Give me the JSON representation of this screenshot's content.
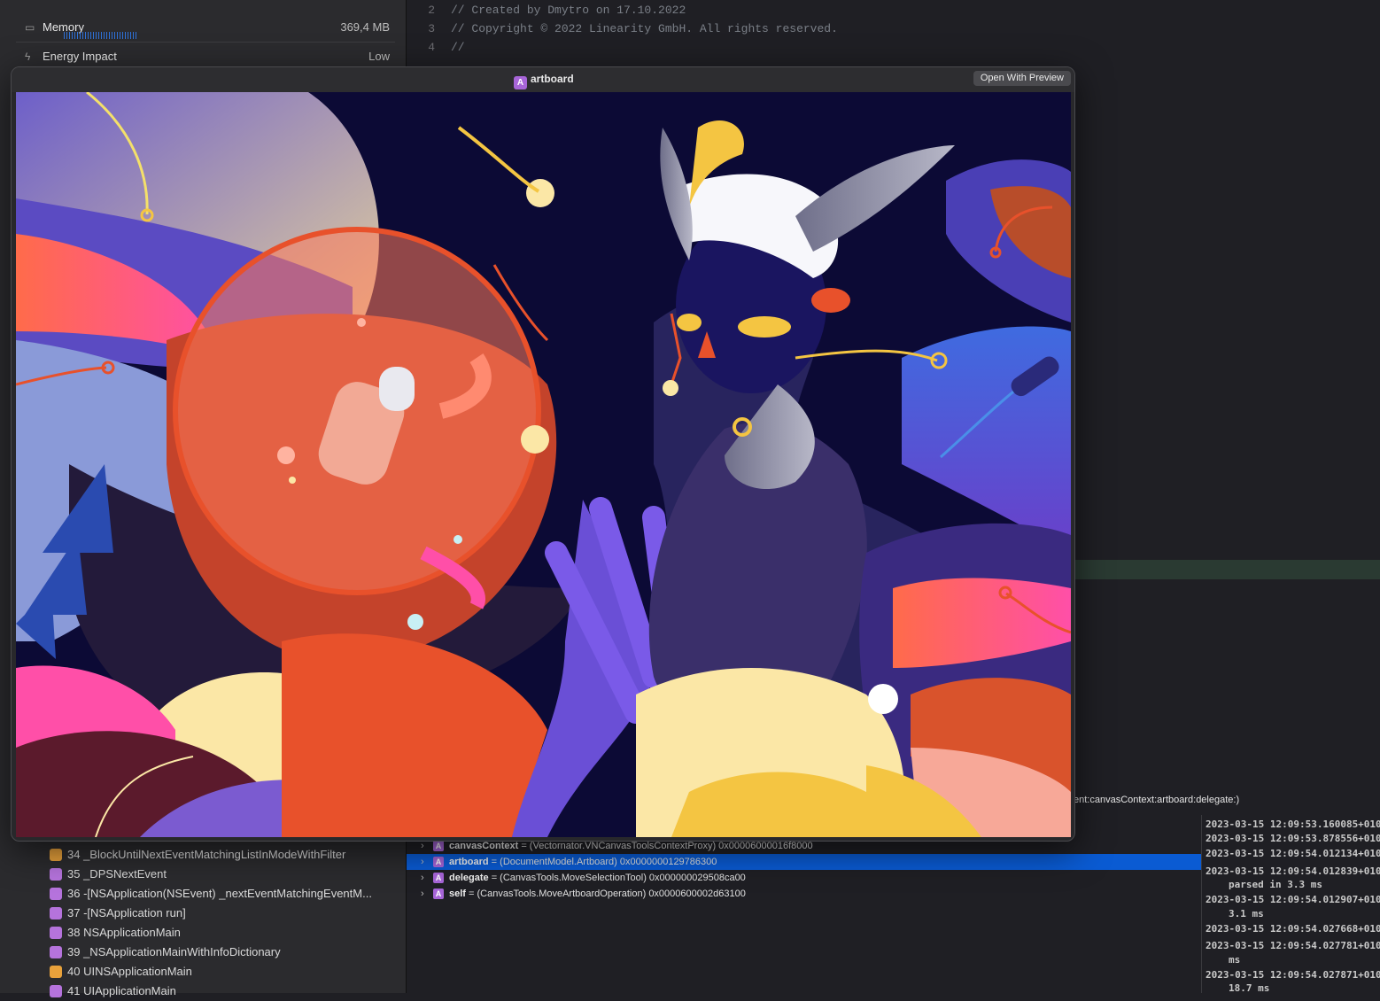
{
  "gauges": [
    {
      "label": "Memory",
      "value": "369,4 MB",
      "icon": "memory-chip-icon"
    },
    {
      "label": "Energy Impact",
      "value": "Low",
      "icon": "bolt-icon"
    }
  ],
  "frames": [
    {
      "text": "34 _BlockUntilNextEventMatchingListInModeWithFilter",
      "badge": "orange"
    },
    {
      "text": "35 _DPSNextEvent",
      "badge": "purple"
    },
    {
      "text": "36 -[NSApplication(NSEvent) _nextEventMatchingEventM...",
      "badge": "purple"
    },
    {
      "text": "37 -[NSApplication run]",
      "badge": "purple"
    },
    {
      "text": "38 NSApplicationMain",
      "badge": "purple"
    },
    {
      "text": "39 _NSApplicationMainWithInfoDictionary",
      "badge": "purple"
    },
    {
      "text": "40 UINSApplicationMain",
      "badge": "orange"
    },
    {
      "text": "41 UIApplicationMain",
      "badge": "purple"
    }
  ],
  "code": [
    {
      "n": "2",
      "text": "//  Created by Dmytro on 17.10.2022"
    },
    {
      "n": "3",
      "text": "//  Copyright © 2022 Linearity GmbH. All rights reserved."
    },
    {
      "n": "4",
      "text": "//"
    }
  ],
  "stack_header": "ent:canvasContext:artboard:delegate:)",
  "variables": [
    {
      "name": "canvasContext",
      "value": " = (Vectornator.VNCanvasToolsContextProxy) 0x00006000016f8000",
      "selected": false
    },
    {
      "name": "artboard",
      "value": " = (DocumentModel.Artboard) 0x0000000129786300",
      "selected": true
    },
    {
      "name": "delegate",
      "value": " = (CanvasTools.MoveSelectionTool) 0x000000029508ca00",
      "selected": false
    },
    {
      "name": "self",
      "value": " = (CanvasTools.MoveArtboardOperation) 0x0000600002d63100",
      "selected": false
    }
  ],
  "console": [
    {
      "text": "2023-03-15 12:09:53.160085+010"
    },
    {
      "text": "2023-03-15 12:09:53.878556+010"
    },
    {
      "text": "2023-03-15 12:09:54.012134+010"
    },
    {
      "text": "2023-03-15 12:09:54.012839+010"
    },
    {
      "text": "parsed in 3.3 ms",
      "cont": true
    },
    {
      "text": "2023-03-15 12:09:54.012907+010"
    },
    {
      "text": "3.1 ms",
      "cont": true
    },
    {
      "text": "2023-03-15 12:09:54.027668+010"
    },
    {
      "text": "2023-03-15 12:09:54.027781+010"
    },
    {
      "text": "ms",
      "cont": true
    },
    {
      "text": "2023-03-15 12:09:54.027871+010"
    },
    {
      "text": "18.7 ms",
      "cont": true
    }
  ],
  "quicklook": {
    "title": "artboard",
    "badge_letter": "A",
    "open_button": "Open With Preview"
  },
  "colors": {
    "selection": "#0a5bd3",
    "type_badge": "#a765d8",
    "art_background": "#0c0a35"
  }
}
